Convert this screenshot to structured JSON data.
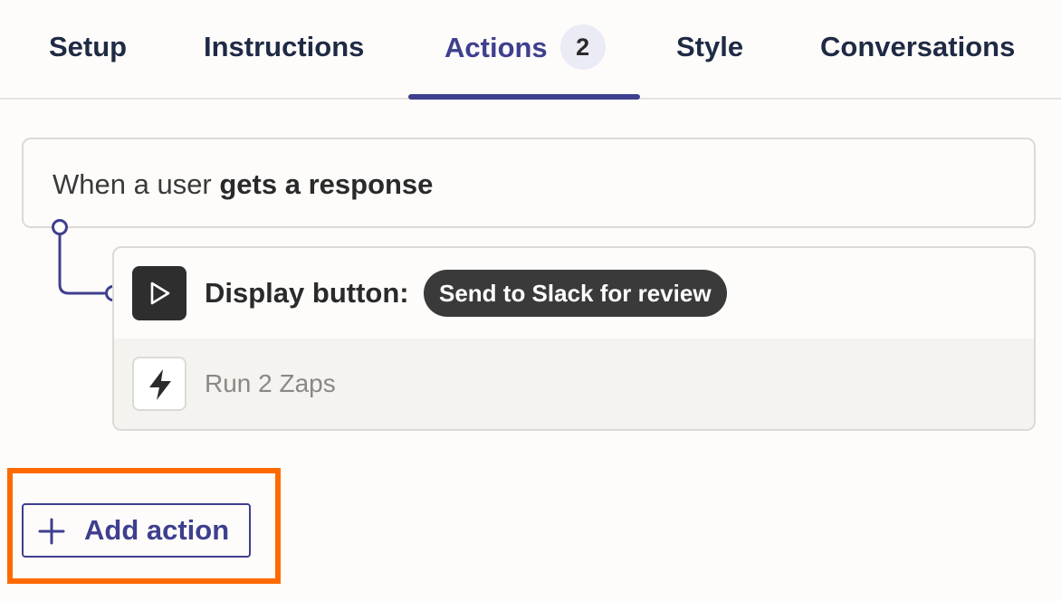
{
  "tabs": [
    {
      "label": "Setup"
    },
    {
      "label": "Instructions"
    },
    {
      "label": "Actions",
      "count": "2",
      "active": true
    },
    {
      "label": "Style"
    },
    {
      "label": "Conversations"
    }
  ],
  "trigger": {
    "prefix": "When a user ",
    "event": "gets a response"
  },
  "action": {
    "icon": "play-icon",
    "label": "Display button:",
    "button_text": "Send to Slack for review"
  },
  "zaps": {
    "icon": "lightning-icon",
    "label": "Run 2 Zaps"
  },
  "add_action": {
    "icon": "plus-icon",
    "label": "Add action"
  },
  "colors": {
    "accent": "#3f3f8f",
    "highlight": "#ff6a00",
    "background": "#fdfcfa"
  }
}
